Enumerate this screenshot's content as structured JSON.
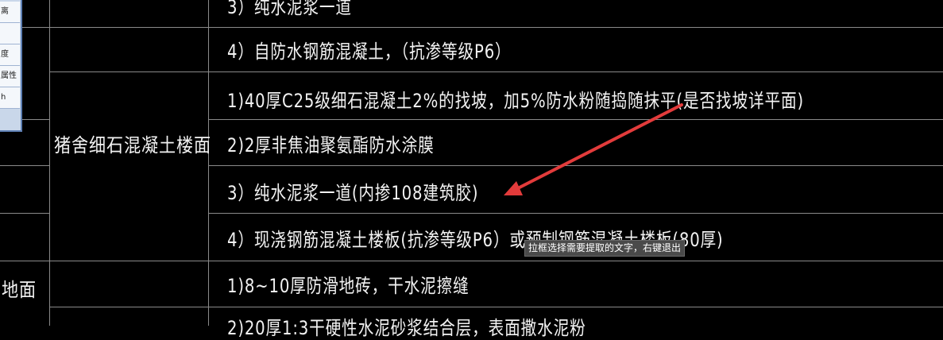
{
  "side_panel": {
    "rows": [
      "离",
      "",
      "度",
      "属性",
      "h"
    ]
  },
  "table": {
    "left_labels": {
      "section_label": "猪舍细石混凝土楼面",
      "ground_label": "地面"
    },
    "lines": [
      "3）纯水泥浆一道",
      "4）自防水钢筋混凝土，（抗渗等级P6）",
      "1)40厚C25级细石混凝土2%的找坡，加5%防水粉随捣随抹平(是否找坡详平面)",
      "2)2厚非焦油聚氨酯防水涂膜",
      "3）纯水泥浆一道(内掺108建筑胶)",
      "4）现浇钢筋混凝土楼板(抗渗等级P6）或预制钢筋混凝土楼板(80厚)",
      "1)8~10厚防滑地砖，干水泥擦缝",
      "2)20厚1:3干硬性水泥砂浆结合层，表面撒水泥粉"
    ]
  },
  "tooltip": {
    "text": "拉框选择需要提取的文字，右键退出"
  },
  "colors": {
    "background": "#000000",
    "grid": "#8a8a8a",
    "text": "#f2f2f2",
    "arrow": "#e23b3b"
  }
}
